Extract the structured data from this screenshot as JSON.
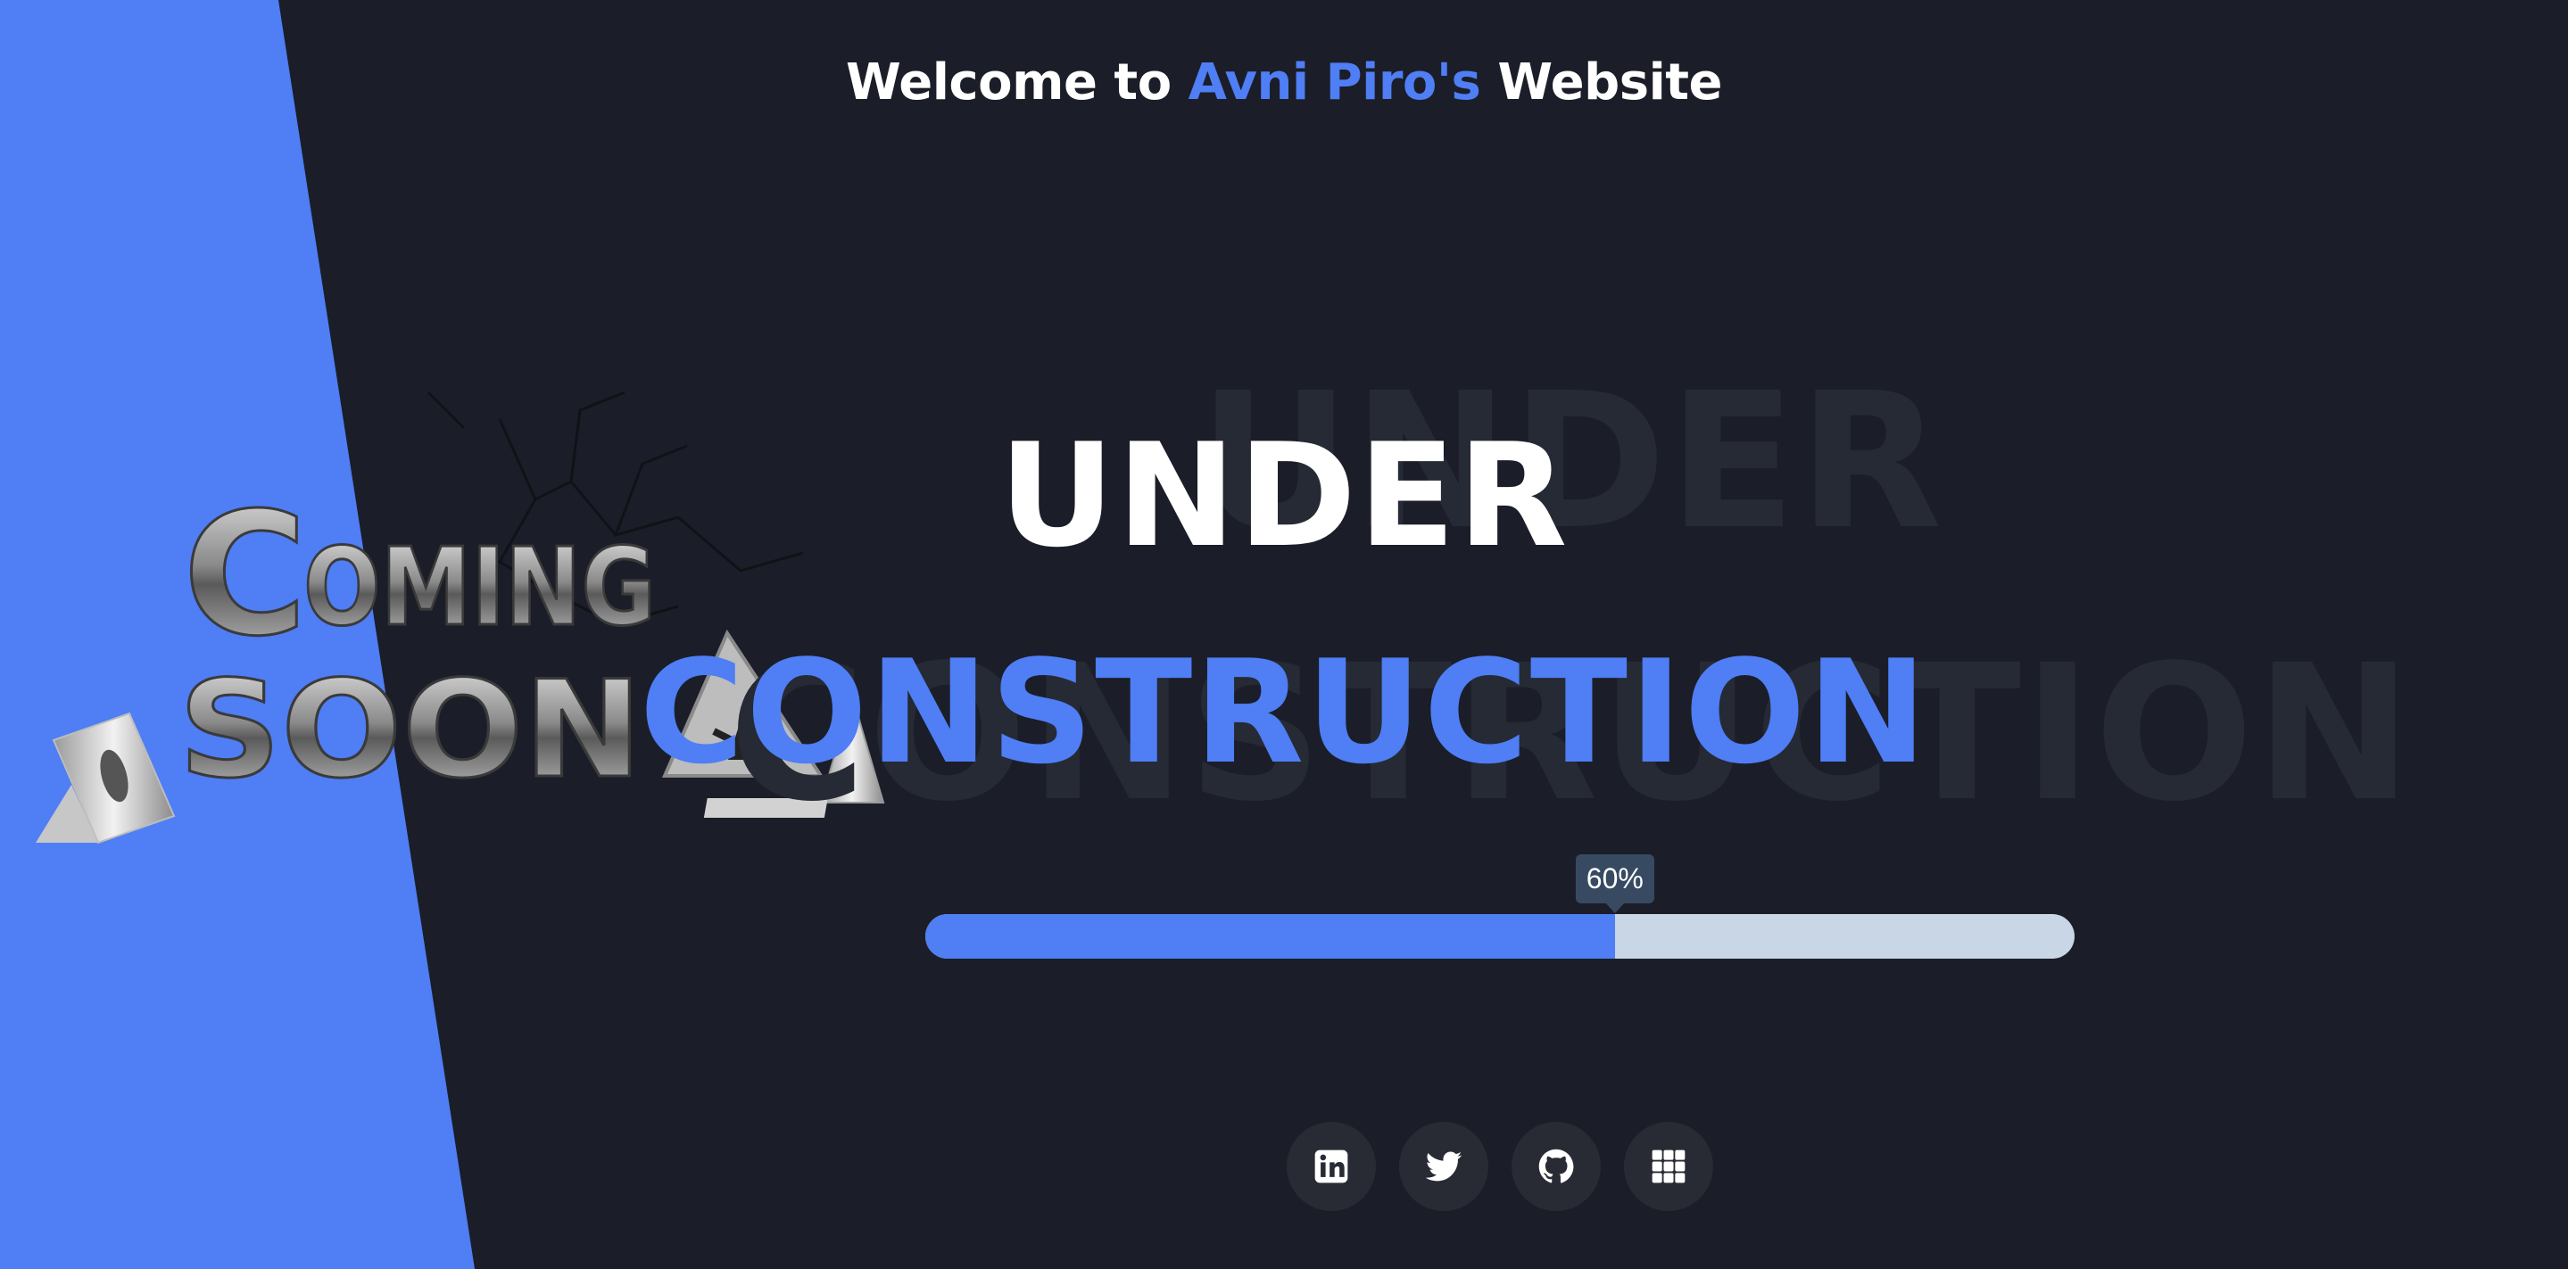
{
  "header": {
    "prefix": "Welcome to",
    "name": "Avni Piro's",
    "suffix": "Website"
  },
  "hero": {
    "line1": "UNDER",
    "line2": "CONSTRUCTION",
    "ghost_line1": "UNDER",
    "ghost_line2": "CONSTRUCTION",
    "artwork_text_top": "COMING",
    "artwork_text_bottom": "SOON"
  },
  "progress": {
    "value": 60,
    "label": "60%"
  },
  "socials": [
    {
      "name": "linkedin-icon"
    },
    {
      "name": "twitter-icon"
    },
    {
      "name": "github-icon"
    },
    {
      "name": "apps-grid-icon"
    }
  ],
  "colors": {
    "background": "#1b1e28",
    "accent": "#4f7ef5",
    "progress_track": "#c8d6e5",
    "tooltip": "#374a62",
    "social_bg": "#282b34"
  }
}
